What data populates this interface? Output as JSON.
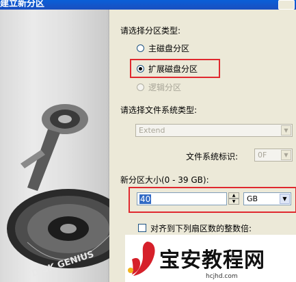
{
  "window": {
    "title": "建立新分区"
  },
  "partition_type": {
    "heading": "请选择分区类型:",
    "options": [
      {
        "label": "主磁盘分区",
        "checked": false,
        "disabled": false
      },
      {
        "label": "扩展磁盘分区",
        "checked": true,
        "disabled": false
      },
      {
        "label": "逻辑分区",
        "checked": false,
        "disabled": true
      }
    ]
  },
  "filesystem": {
    "heading": "请选择文件系统类型:",
    "type_value": "Extend",
    "id_label": "文件系统标识:",
    "id_value": "0F"
  },
  "size": {
    "label": "新分区大小(0 - 39 GB):",
    "value": "40",
    "unit": "GB"
  },
  "align": {
    "label": "对齐到下列扇区数的整数倍:"
  },
  "banner": {
    "brand": "DISK GENIUS"
  },
  "watermark": {
    "text": "宝安教程网",
    "url": "hcjhd.com"
  }
}
